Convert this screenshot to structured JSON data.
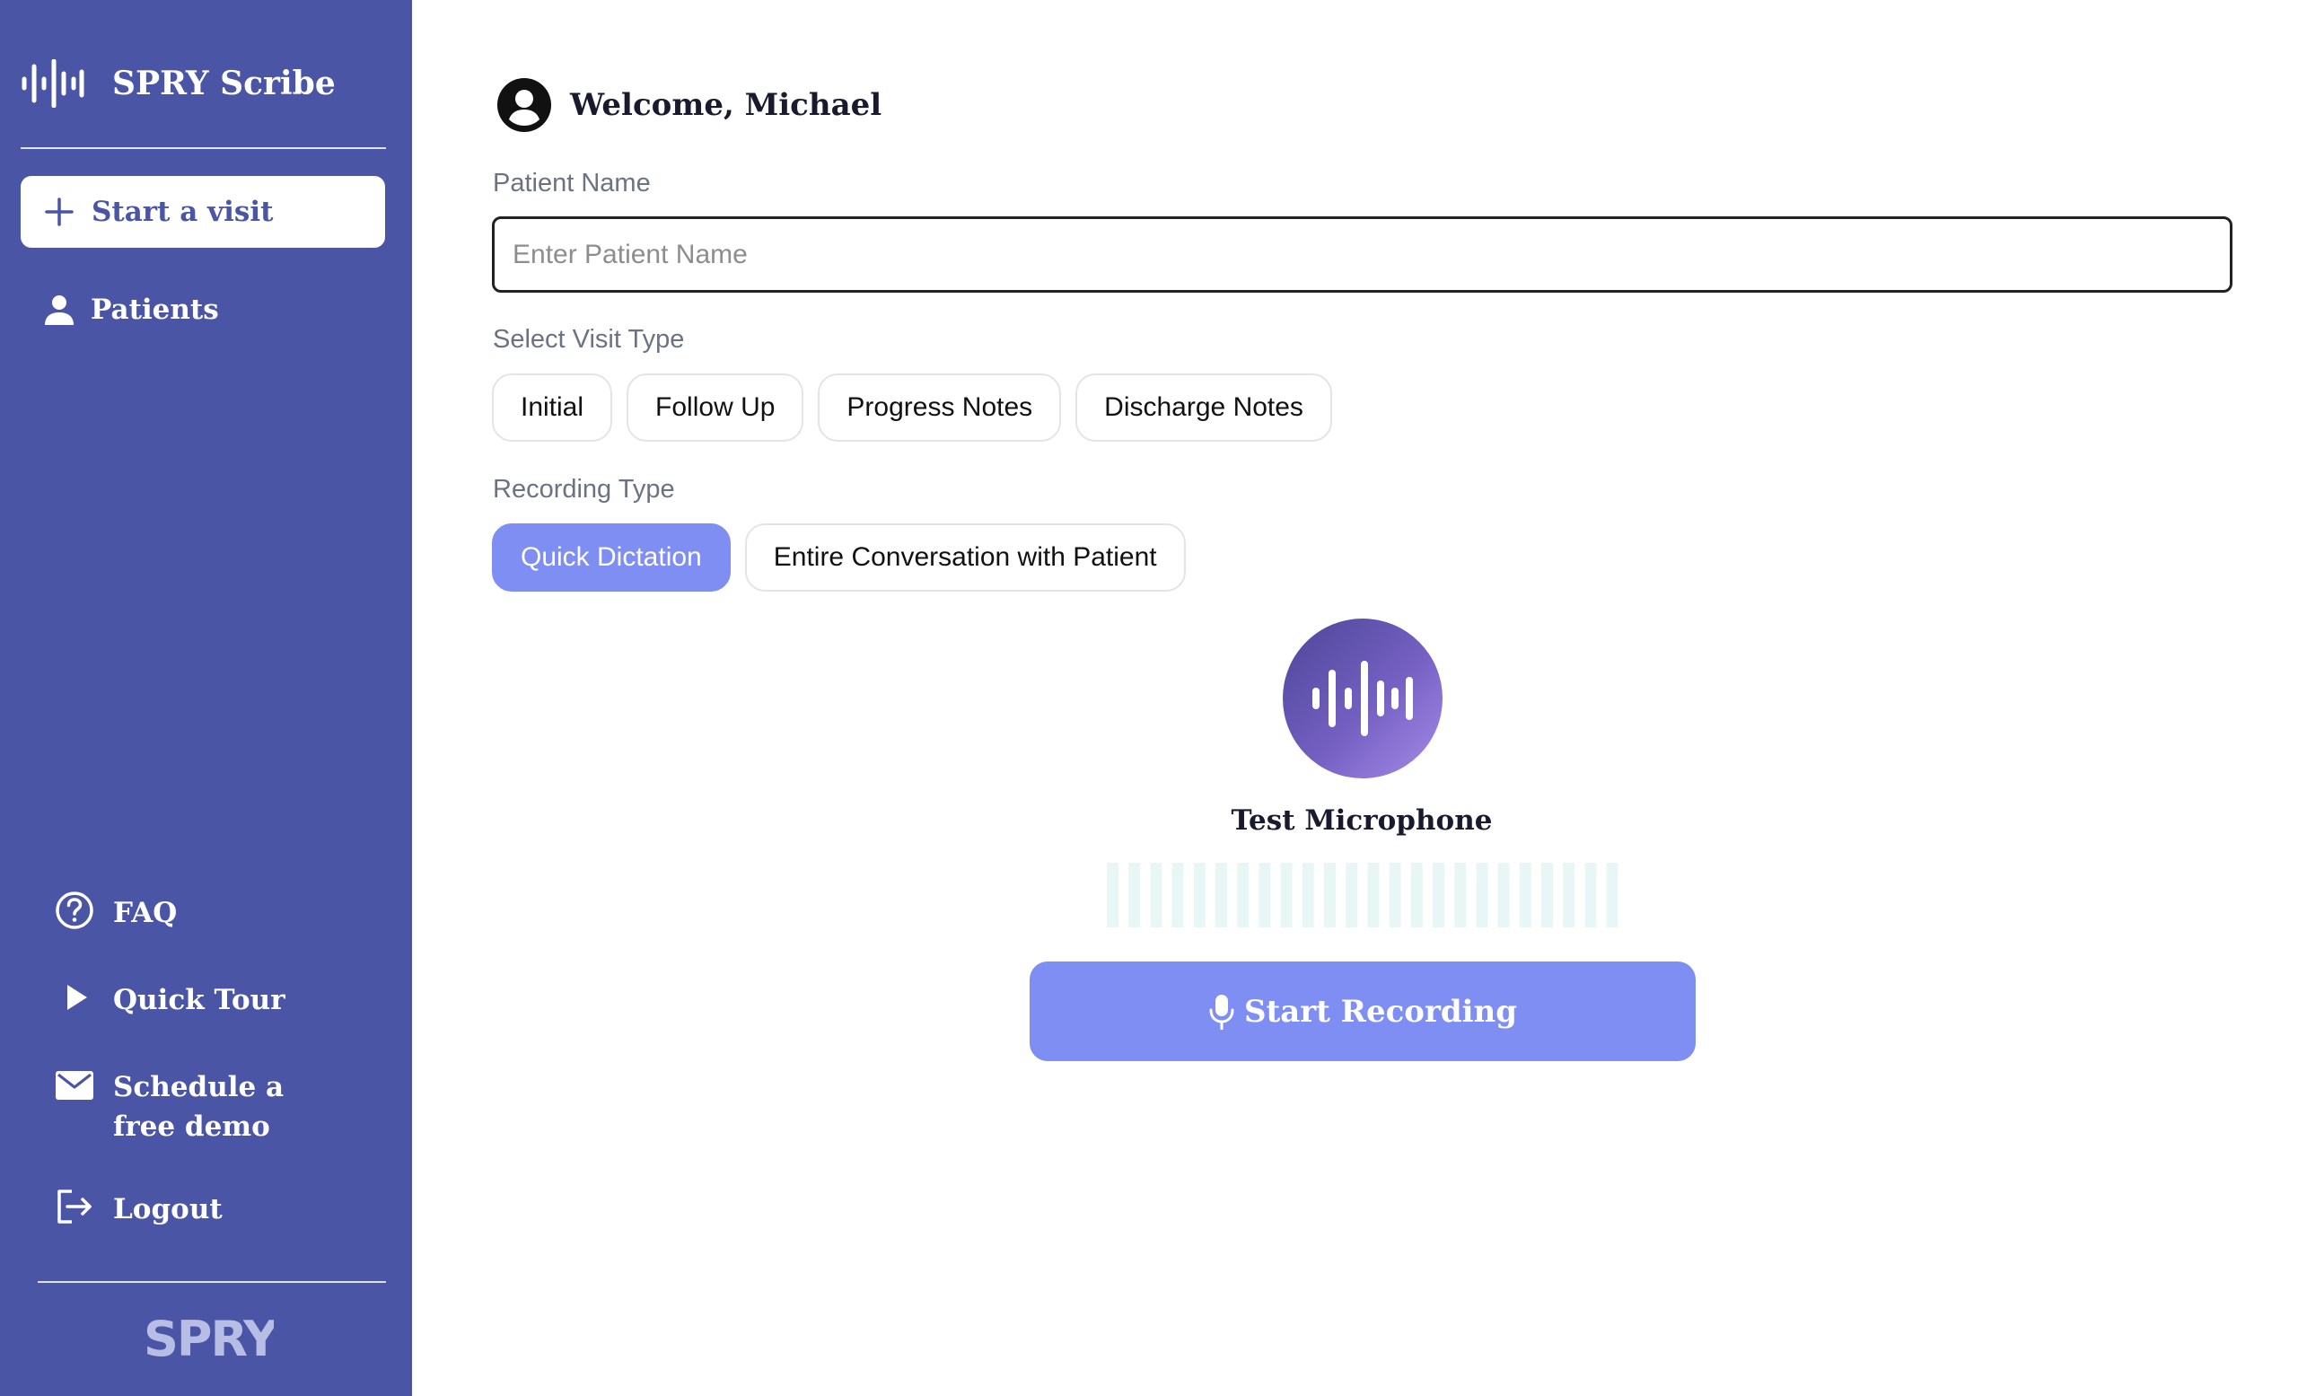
{
  "sidebar": {
    "brand_name": "SPRY Scribe",
    "start_visit_label": "Start a visit",
    "patients_label": "Patients",
    "bottom_items": {
      "faq": "FAQ",
      "quick_tour": "Quick Tour",
      "schedule_demo": "Schedule a free demo",
      "logout": "Logout"
    },
    "footer_logo_text": "SPRY"
  },
  "main": {
    "welcome_text": "Welcome, Michael",
    "patient_name_label": "Patient Name",
    "patient_name_placeholder": "Enter Patient Name",
    "patient_name_value": "",
    "visit_type_label": "Select Visit Type",
    "visit_types": [
      "Initial",
      "Follow Up",
      "Progress Notes",
      "Discharge Notes"
    ],
    "recording_type_label": "Recording Type",
    "recording_types": [
      "Quick Dictation",
      "Entire Conversation with Patient"
    ],
    "selected_recording_type": "Quick Dictation",
    "test_microphone_label": "Test Microphone",
    "microphone_level": 0,
    "start_recording_label": "Start Recording"
  },
  "colors": {
    "sidebar_bg": "#4a55a5",
    "accent": "#7e8ef3",
    "meter_bar": "#e9f6f6",
    "text_dark": "#1a1a2e",
    "label_gray": "#6b7283"
  },
  "icons": {
    "brand": "waveform-icon",
    "start_visit": "plus-icon",
    "patients": "person-icon",
    "faq": "question-circle-icon",
    "quick_tour": "play-icon",
    "schedule_demo": "envelope-icon",
    "logout": "logout-icon",
    "welcome": "user-circle-icon",
    "mic_circle": "waveform-icon",
    "start_recording": "microphone-icon"
  }
}
